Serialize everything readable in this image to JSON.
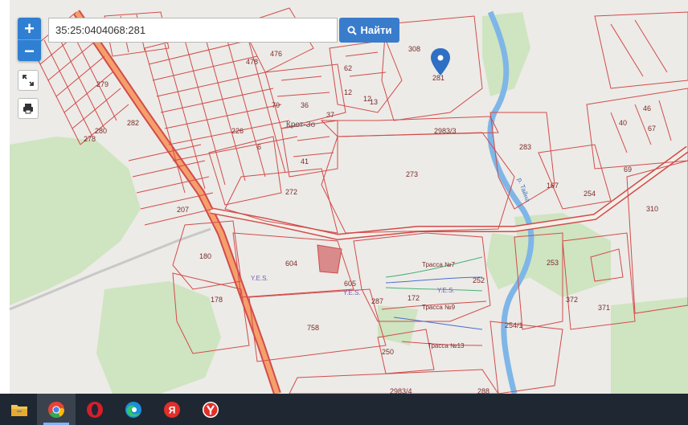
{
  "search": {
    "value": "35:25:0404068:281",
    "button_label": "Найти"
  },
  "map": {
    "parcel_labels": [
      "308",
      "281",
      "2983/3",
      "283",
      "273",
      "272",
      "604",
      "605",
      "180",
      "178",
      "758",
      "172",
      "252",
      "287",
      "250",
      "167",
      "253",
      "254",
      "310",
      "372",
      "371",
      "254/1",
      "226",
      "207",
      "2983/4",
      "288",
      "279",
      "282",
      "278",
      "280",
      "476",
      "478",
      "70",
      "36",
      "37",
      "41",
      "62",
      "40",
      "46",
      "67",
      "69",
      "12",
      "13",
      "6",
      "12"
    ],
    "places": [
      "Крот-Зо",
      "р. Тайна"
    ],
    "trails": [
      "Трасса №7",
      "Трасса №9",
      "Трасса №13"
    ],
    "poi_label": "Y.E.S.",
    "marker_label": "281"
  },
  "taskbar": {
    "apps": [
      "file-explorer",
      "chrome",
      "opera",
      "edge",
      "yandex",
      "yandex-browser"
    ]
  },
  "colors": {
    "accent": "#3a7ccc",
    "parcel_line": "#d24b4b",
    "road_fill": "#f5a06b",
    "forest": "#cfe4c0",
    "river": "#7fb6e8"
  }
}
